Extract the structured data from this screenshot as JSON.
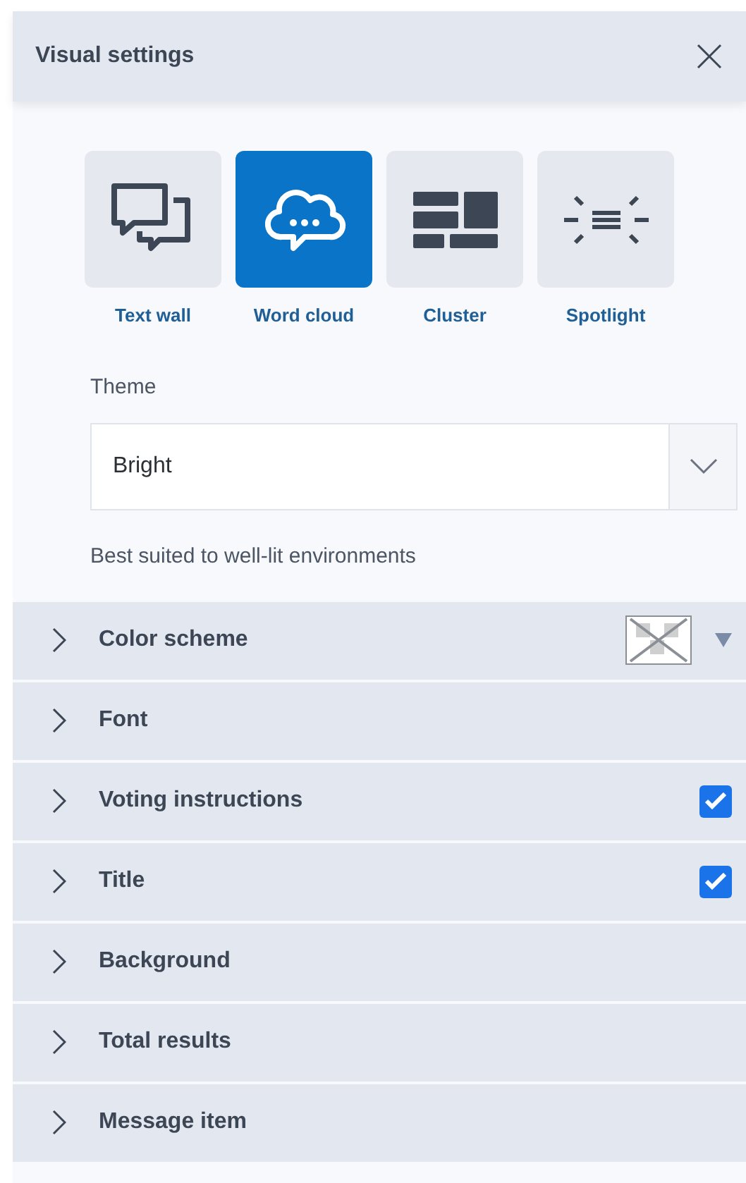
{
  "panel": {
    "title": "Visual settings"
  },
  "layouts": [
    {
      "label": "Text wall",
      "kind": "text-wall",
      "selected": false
    },
    {
      "label": "Word cloud",
      "kind": "word-cloud",
      "selected": true
    },
    {
      "label": "Cluster",
      "kind": "cluster",
      "selected": false
    },
    {
      "label": "Spotlight",
      "kind": "spotlight",
      "selected": false
    }
  ],
  "theme": {
    "label": "Theme",
    "value": "Bright",
    "hint": "Best suited to well-lit environments"
  },
  "sections": [
    {
      "label": "Color scheme",
      "kind": "swatch",
      "expanded": false
    },
    {
      "label": "Font",
      "kind": "plain",
      "expanded": false
    },
    {
      "label": "Voting instructions",
      "kind": "checkbox",
      "checked": true,
      "expanded": false
    },
    {
      "label": "Title",
      "kind": "checkbox",
      "checked": true,
      "expanded": false
    },
    {
      "label": "Background",
      "kind": "plain",
      "expanded": false
    },
    {
      "label": "Total results",
      "kind": "plain",
      "expanded": false
    },
    {
      "label": "Message item",
      "kind": "plain",
      "expanded": false
    }
  ]
}
